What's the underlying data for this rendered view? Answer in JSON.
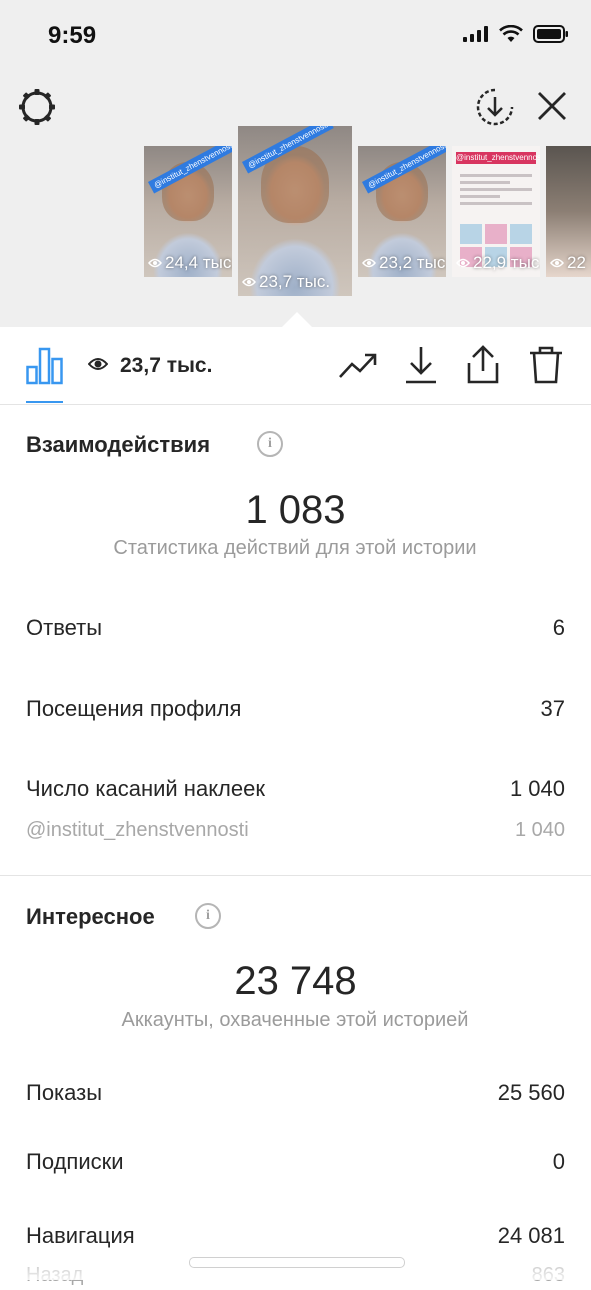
{
  "status_bar": {
    "time": "9:59"
  },
  "stories": [
    {
      "views": "24,4 тыс.",
      "sticker": "@institut_zhenstvennosti"
    },
    {
      "views": "23,7 тыс.",
      "sticker": "@institut_zhenstvennosti",
      "selected": true
    },
    {
      "views": "23,2 тыс.",
      "sticker": "@institut_zhenstvennosti"
    },
    {
      "views": "22,9 тыс.",
      "sticker": "@institut_zhenstvennosti"
    },
    {
      "views": "22"
    }
  ],
  "toolbar": {
    "reach": "23,7 тыс."
  },
  "interactions": {
    "title": "Взаимодействия",
    "total": "1 083",
    "caption": "Статистика действий для этой истории",
    "rows": [
      {
        "label": "Ответы",
        "value": "6"
      },
      {
        "label": "Посещения профиля",
        "value": "37"
      },
      {
        "label": "Число касаний наклеек",
        "value": "1 040"
      },
      {
        "label": "@institut_zhenstvennosti",
        "value": "1 040"
      }
    ]
  },
  "discovery": {
    "title": "Интересное",
    "total": "23 748",
    "caption": "Аккаунты, охваченные этой историей",
    "rows": [
      {
        "label": "Показы",
        "value": "25 560"
      },
      {
        "label": "Подписки",
        "value": "0"
      },
      {
        "label": "Навигация",
        "value": "24 081"
      },
      {
        "label": "Назад",
        "value": "863"
      }
    ]
  },
  "colors": {
    "accent": "#3897f0",
    "background_top": "#efefef"
  }
}
